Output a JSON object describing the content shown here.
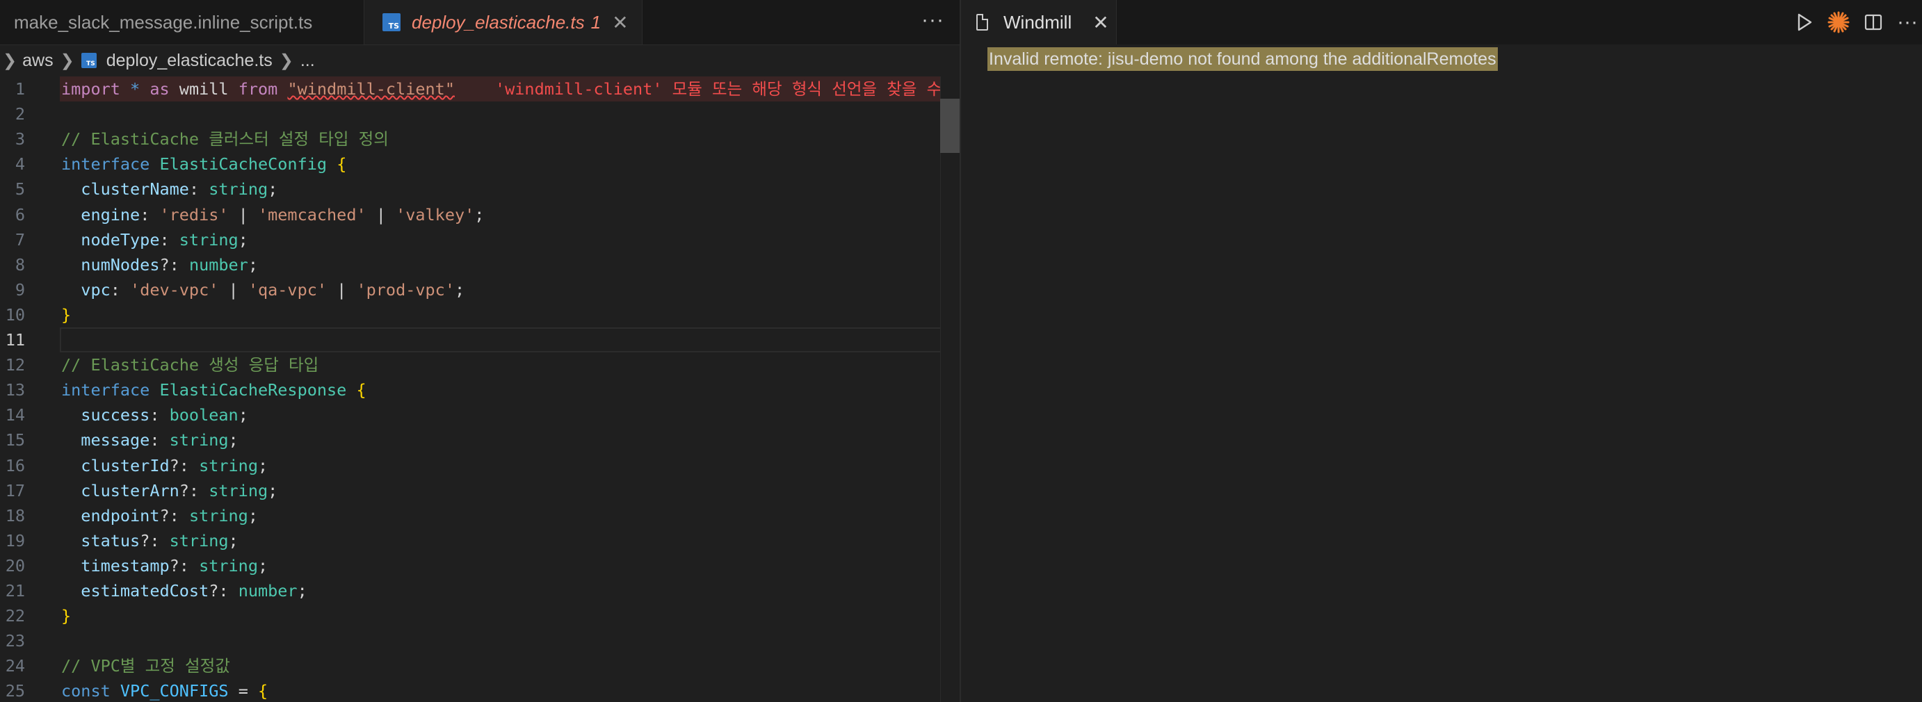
{
  "left_group": {
    "tabs": [
      {
        "label": "make_slack_message.inline_script.ts",
        "active": false
      },
      {
        "label": "deploy_elasticache.ts",
        "problems": "1",
        "active": true
      }
    ],
    "more": "···"
  },
  "breadcrumb": {
    "folder": "aws",
    "file": "deploy_elasticache.ts",
    "more": "..."
  },
  "editor": {
    "current_line": 11,
    "line_numbers": [
      "1",
      "2",
      "3",
      "4",
      "5",
      "6",
      "7",
      "8",
      "9",
      "10",
      "11",
      "12",
      "13",
      "14",
      "15",
      "16",
      "17",
      "18",
      "19",
      "20",
      "21",
      "22",
      "23",
      "24",
      "25"
    ],
    "error_message": "'windmill-client' 모듈 또는 해당 형식 선언을 찾을 수 없",
    "lines": [
      [
        [
          "kw",
          "import"
        ],
        [
          "plain",
          " "
        ],
        [
          "key",
          "*"
        ],
        [
          "plain",
          " "
        ],
        [
          "kw",
          "as"
        ],
        [
          "plain",
          " wmill "
        ],
        [
          "kw",
          "from"
        ],
        [
          "plain",
          " "
        ],
        [
          "strsq",
          "\"windmill-client\""
        ]
      ],
      [],
      [
        [
          "comment",
          "// ElastiCache 클러스터 설정 타입 정의"
        ]
      ],
      [
        [
          "key",
          "interface"
        ],
        [
          "plain",
          " "
        ],
        [
          "type",
          "ElastiCacheConfig"
        ],
        [
          "plain",
          " "
        ],
        [
          "brace",
          "{"
        ]
      ],
      [
        [
          "plain",
          "  "
        ],
        [
          "prop",
          "clusterName"
        ],
        [
          "plain",
          ": "
        ],
        [
          "type",
          "string"
        ],
        [
          "plain",
          ";"
        ]
      ],
      [
        [
          "plain",
          "  "
        ],
        [
          "prop",
          "engine"
        ],
        [
          "plain",
          ": "
        ],
        [
          "str",
          "'redis'"
        ],
        [
          "plain",
          " | "
        ],
        [
          "str",
          "'memcached'"
        ],
        [
          "plain",
          " | "
        ],
        [
          "str",
          "'valkey'"
        ],
        [
          "plain",
          ";"
        ]
      ],
      [
        [
          "plain",
          "  "
        ],
        [
          "prop",
          "nodeType"
        ],
        [
          "plain",
          ": "
        ],
        [
          "type",
          "string"
        ],
        [
          "plain",
          ";"
        ]
      ],
      [
        [
          "plain",
          "  "
        ],
        [
          "prop",
          "numNodes"
        ],
        [
          "plain",
          "?: "
        ],
        [
          "type",
          "number"
        ],
        [
          "plain",
          ";"
        ]
      ],
      [
        [
          "plain",
          "  "
        ],
        [
          "prop",
          "vpc"
        ],
        [
          "plain",
          ": "
        ],
        [
          "str",
          "'dev-vpc'"
        ],
        [
          "plain",
          " | "
        ],
        [
          "str",
          "'qa-vpc'"
        ],
        [
          "plain",
          " | "
        ],
        [
          "str",
          "'prod-vpc'"
        ],
        [
          "plain",
          ";"
        ]
      ],
      [
        [
          "brace",
          "}"
        ]
      ],
      [],
      [
        [
          "comment",
          "// ElastiCache 생성 응답 타입"
        ]
      ],
      [
        [
          "key",
          "interface"
        ],
        [
          "plain",
          " "
        ],
        [
          "type",
          "ElastiCacheResponse"
        ],
        [
          "plain",
          " "
        ],
        [
          "brace",
          "{"
        ]
      ],
      [
        [
          "plain",
          "  "
        ],
        [
          "prop",
          "success"
        ],
        [
          "plain",
          ": "
        ],
        [
          "type",
          "boolean"
        ],
        [
          "plain",
          ";"
        ]
      ],
      [
        [
          "plain",
          "  "
        ],
        [
          "prop",
          "message"
        ],
        [
          "plain",
          ": "
        ],
        [
          "type",
          "string"
        ],
        [
          "plain",
          ";"
        ]
      ],
      [
        [
          "plain",
          "  "
        ],
        [
          "prop",
          "clusterId"
        ],
        [
          "plain",
          "?: "
        ],
        [
          "type",
          "string"
        ],
        [
          "plain",
          ";"
        ]
      ],
      [
        [
          "plain",
          "  "
        ],
        [
          "prop",
          "clusterArn"
        ],
        [
          "plain",
          "?: "
        ],
        [
          "type",
          "string"
        ],
        [
          "plain",
          ";"
        ]
      ],
      [
        [
          "plain",
          "  "
        ],
        [
          "prop",
          "endpoint"
        ],
        [
          "plain",
          "?: "
        ],
        [
          "type",
          "string"
        ],
        [
          "plain",
          ";"
        ]
      ],
      [
        [
          "plain",
          "  "
        ],
        [
          "prop",
          "status"
        ],
        [
          "plain",
          "?: "
        ],
        [
          "type",
          "string"
        ],
        [
          "plain",
          ";"
        ]
      ],
      [
        [
          "plain",
          "  "
        ],
        [
          "prop",
          "timestamp"
        ],
        [
          "plain",
          "?: "
        ],
        [
          "type",
          "string"
        ],
        [
          "plain",
          ";"
        ]
      ],
      [
        [
          "plain",
          "  "
        ],
        [
          "prop",
          "estimatedCost"
        ],
        [
          "plain",
          "?: "
        ],
        [
          "type",
          "number"
        ],
        [
          "plain",
          ";"
        ]
      ],
      [
        [
          "brace",
          "}"
        ]
      ],
      [],
      [
        [
          "comment",
          "// VPC별 고정 설정값"
        ]
      ],
      [
        [
          "key",
          "const"
        ],
        [
          "plain",
          " "
        ],
        [
          "var",
          "VPC_CONFIGS"
        ],
        [
          "plain",
          " = "
        ],
        [
          "brace",
          "{"
        ]
      ]
    ]
  },
  "windmill": {
    "tab_label": "Windmill",
    "message": "Invalid remote: jisu-demo not found among the additionalRemotes",
    "more": "···"
  },
  "colors": {
    "accent_ts": "#3178c6",
    "error": "#f14c4c",
    "windmill_orange": "#f07c2c",
    "warning_highlight": "#8c7e4b"
  },
  "icons": [
    "typescript-file-icon",
    "file-icon",
    "close-icon",
    "run-icon",
    "windmill-icon",
    "split-editor-icon",
    "ellipsis-icon",
    "chevron-right-icon"
  ]
}
